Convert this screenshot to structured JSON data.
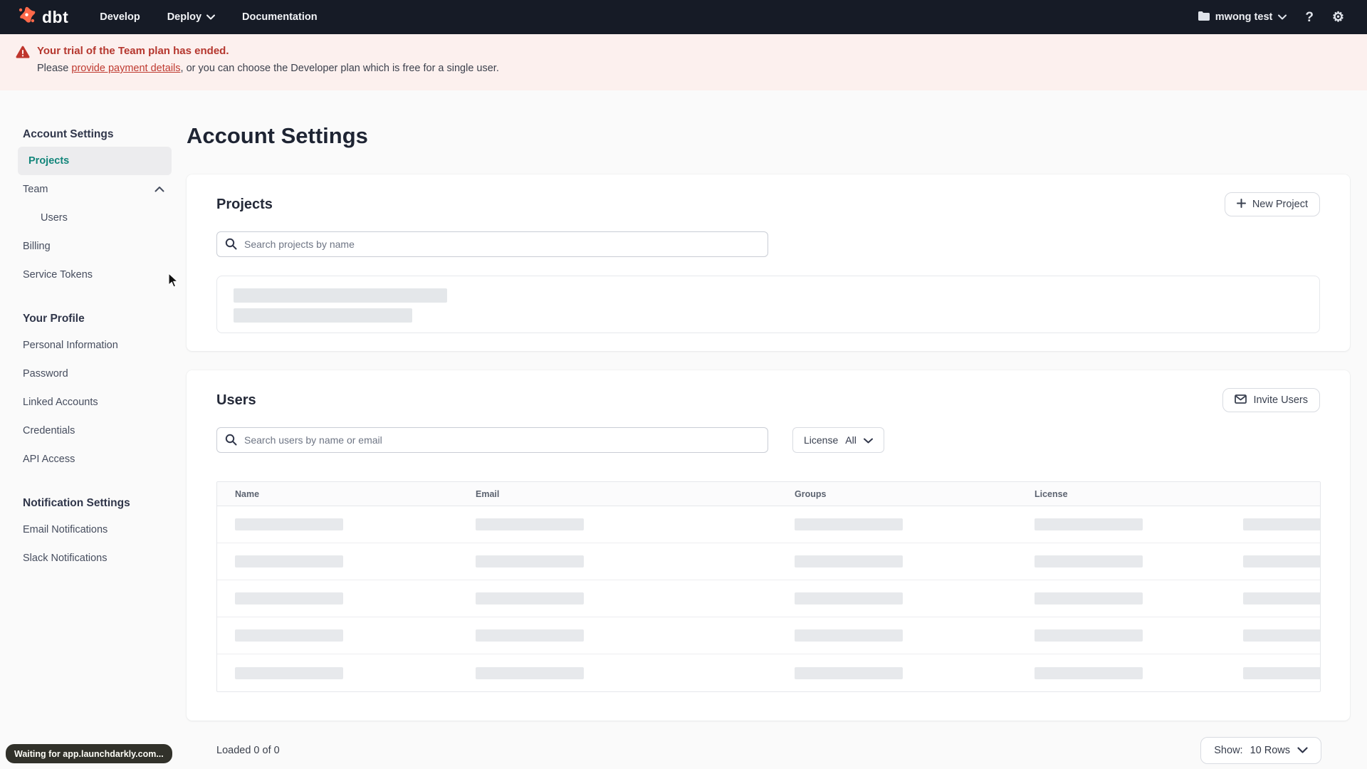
{
  "nav": {
    "logo_text": "dbt",
    "links": [
      {
        "label": "Develop"
      },
      {
        "label": "Deploy"
      },
      {
        "label": "Documentation"
      }
    ],
    "account_label": "mwong test",
    "help_label": "?"
  },
  "banner": {
    "title": "Your trial of the Team plan has ended.",
    "body_prefix": "Please ",
    "link_text": "provide payment details",
    "body_suffix": ", or you can choose the Developer plan which is free for a single user."
  },
  "sidebar": {
    "sections": [
      {
        "heading": "Account Settings",
        "items": [
          {
            "label": "Projects"
          },
          {
            "label": "Team"
          },
          {
            "label": "Users"
          },
          {
            "label": "Billing"
          },
          {
            "label": "Service Tokens"
          }
        ]
      },
      {
        "heading": "Your Profile",
        "items": [
          {
            "label": "Personal Information"
          },
          {
            "label": "Password"
          },
          {
            "label": "Linked Accounts"
          },
          {
            "label": "Credentials"
          },
          {
            "label": "API Access"
          }
        ]
      },
      {
        "heading": "Notification Settings",
        "items": [
          {
            "label": "Email Notifications"
          },
          {
            "label": "Slack Notifications"
          }
        ]
      }
    ]
  },
  "main": {
    "page_title": "Account Settings",
    "projects_card": {
      "title": "Projects",
      "new_project_label": "New Project",
      "search_placeholder": "Search projects by name"
    },
    "users_card": {
      "title": "Users",
      "invite_label": "Invite Users",
      "search_placeholder": "Search users by name or email",
      "license_filter": {
        "label": "License",
        "value": "All"
      },
      "table": {
        "columns": [
          "Name",
          "Email",
          "Groups",
          "License"
        ],
        "skeleton_rows": 5
      },
      "footer": {
        "loaded_text": "Loaded 0 of 0",
        "show_label": "Show:",
        "show_value": "10 Rows"
      }
    }
  },
  "status_toast": "Waiting for app.launchdarkly.com...",
  "colors": {
    "nav_bg": "#161b26",
    "logo_orange": "#ff694a",
    "banner_bg": "#fcf0ee",
    "alert_red": "#b5372e",
    "accent_teal": "#12857a",
    "skeleton_gray": "#e7e9ec"
  }
}
